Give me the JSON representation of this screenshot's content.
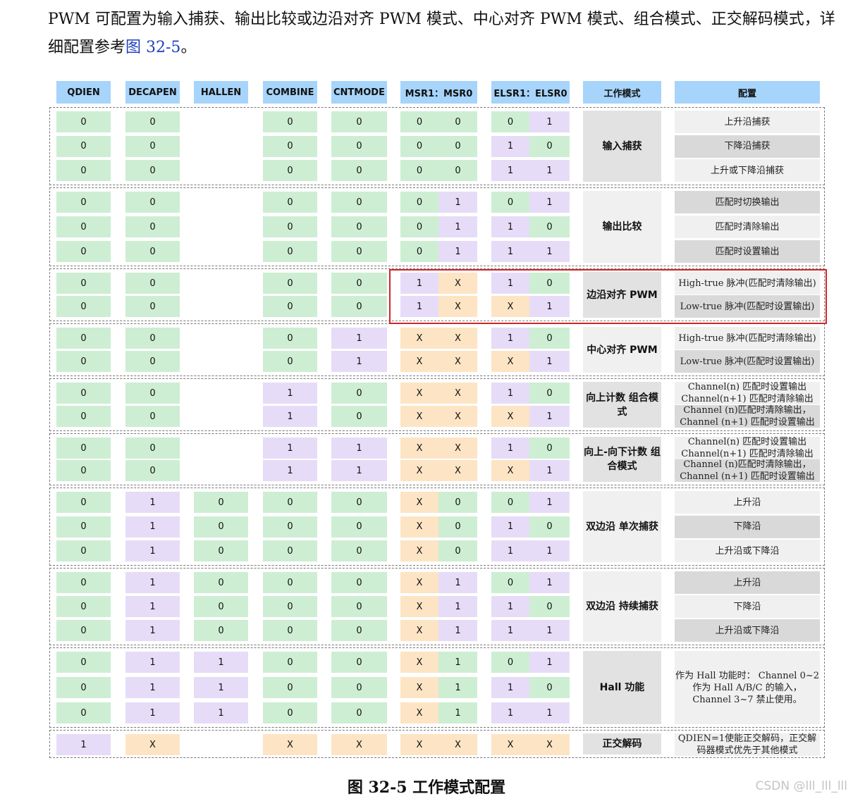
{
  "intro": {
    "text": "PWM 可配置为输入捕获、输出比较或边沿对齐 PWM 模式、中心对齐 PWM 模式、组合模式、正交解码模式，详细配置参考",
    "ref": "图 32-5",
    "tail": "。"
  },
  "headers": [
    "QDIEN",
    "DECAPEN",
    "HALLEN",
    "COMBINE",
    "CNTMODE",
    "MSR1：MSR0",
    "ELSR1：ELSR0",
    "工作模式",
    "配置"
  ],
  "groups": [
    {
      "mode": "输入捕获",
      "rows": [
        {
          "v": [
            "0",
            "0",
            "",
            "0",
            "0",
            "0",
            "0",
            "0",
            "1"
          ],
          "c": [
            "g",
            "g",
            "",
            "g",
            "g",
            "g",
            "g",
            "g",
            "p"
          ],
          "cfg": "上升沿捕获",
          "ct": "l"
        },
        {
          "v": [
            "0",
            "0",
            "",
            "0",
            "0",
            "0",
            "0",
            "1",
            "0"
          ],
          "c": [
            "g",
            "g",
            "",
            "g",
            "g",
            "g",
            "g",
            "p",
            "g"
          ],
          "cfg": "下降沿捕获",
          "ct": "d"
        },
        {
          "v": [
            "0",
            "0",
            "",
            "0",
            "0",
            "0",
            "0",
            "1",
            "1"
          ],
          "c": [
            "g",
            "g",
            "",
            "g",
            "g",
            "g",
            "g",
            "p",
            "p"
          ],
          "cfg": "上升或下降沿捕获",
          "ct": "l"
        }
      ]
    },
    {
      "mode": "输出比较",
      "rows": [
        {
          "v": [
            "0",
            "0",
            "",
            "0",
            "0",
            "0",
            "1",
            "0",
            "1"
          ],
          "c": [
            "g",
            "g",
            "",
            "g",
            "g",
            "g",
            "p",
            "g",
            "p"
          ],
          "cfg": "匹配时切换输出",
          "ct": "d"
        },
        {
          "v": [
            "0",
            "0",
            "",
            "0",
            "0",
            "0",
            "1",
            "1",
            "0"
          ],
          "c": [
            "g",
            "g",
            "",
            "g",
            "g",
            "g",
            "p",
            "p",
            "g"
          ],
          "cfg": "匹配时清除输出",
          "ct": "l"
        },
        {
          "v": [
            "0",
            "0",
            "",
            "0",
            "0",
            "0",
            "1",
            "1",
            "1"
          ],
          "c": [
            "g",
            "g",
            "",
            "g",
            "g",
            "g",
            "p",
            "p",
            "p"
          ],
          "cfg": "匹配时设置输出",
          "ct": "d"
        }
      ]
    },
    {
      "mode": "边沿对齐 PWM",
      "rows": [
        {
          "v": [
            "0",
            "0",
            "",
            "0",
            "0",
            "1",
            "X",
            "1",
            "0"
          ],
          "c": [
            "g",
            "g",
            "",
            "g",
            "g",
            "p",
            "o",
            "p",
            "g"
          ],
          "cfg": "High-true 脉冲(匹配时清除输出)",
          "ct": "l"
        },
        {
          "v": [
            "0",
            "0",
            "",
            "0",
            "0",
            "1",
            "X",
            "X",
            "1"
          ],
          "c": [
            "g",
            "g",
            "",
            "g",
            "g",
            "p",
            "o",
            "o",
            "p"
          ],
          "cfg": "Low-true 脉冲(匹配时设置输出)",
          "ct": "d"
        }
      ]
    },
    {
      "mode": "中心对齐 PWM",
      "rows": [
        {
          "v": [
            "0",
            "0",
            "",
            "0",
            "1",
            "X",
            "X",
            "1",
            "0"
          ],
          "c": [
            "g",
            "g",
            "",
            "g",
            "p",
            "o",
            "o",
            "p",
            "g"
          ],
          "cfg": "High-true 脉冲(匹配时清除输出)",
          "ct": "l"
        },
        {
          "v": [
            "0",
            "0",
            "",
            "0",
            "1",
            "X",
            "X",
            "X",
            "1"
          ],
          "c": [
            "g",
            "g",
            "",
            "g",
            "p",
            "o",
            "o",
            "o",
            "p"
          ],
          "cfg": "Low-true 脉冲(匹配时设置输出)",
          "ct": "d"
        }
      ]
    },
    {
      "mode": "向上计数 组合模式",
      "rows": [
        {
          "v": [
            "0",
            "0",
            "",
            "1",
            "0",
            "X",
            "X",
            "1",
            "0"
          ],
          "c": [
            "g",
            "g",
            "",
            "p",
            "g",
            "o",
            "o",
            "p",
            "g"
          ],
          "cfg": "Channel(n) 匹配时设置输出 Channel(n+1) 匹配时清除输出",
          "ct": "l"
        },
        {
          "v": [
            "0",
            "0",
            "",
            "1",
            "0",
            "X",
            "X",
            "X",
            "1"
          ],
          "c": [
            "g",
            "g",
            "",
            "p",
            "g",
            "o",
            "o",
            "o",
            "p"
          ],
          "cfg": "Channel (n)匹配时清除输出， Channel (n+1) 匹配时设置输出",
          "ct": "d"
        }
      ]
    },
    {
      "mode": "向上-向下计数 组合模式",
      "rows": [
        {
          "v": [
            "0",
            "0",
            "",
            "1",
            "1",
            "X",
            "X",
            "1",
            "0"
          ],
          "c": [
            "g",
            "g",
            "",
            "p",
            "p",
            "o",
            "o",
            "p",
            "g"
          ],
          "cfg": "Channel(n) 匹配时设置输出 Channel(n+1) 匹配时清除输出",
          "ct": "l"
        },
        {
          "v": [
            "0",
            "0",
            "",
            "1",
            "1",
            "X",
            "X",
            "X",
            "1"
          ],
          "c": [
            "g",
            "g",
            "",
            "p",
            "p",
            "o",
            "o",
            "o",
            "p"
          ],
          "cfg": "Channel (n)匹配时清除输出， Channel (n+1) 匹配时设置输出",
          "ct": "d"
        }
      ]
    },
    {
      "mode": "双边沿 单次捕获",
      "rows": [
        {
          "v": [
            "0",
            "1",
            "0",
            "0",
            "0",
            "X",
            "0",
            "0",
            "1"
          ],
          "c": [
            "g",
            "p",
            "g",
            "g",
            "g",
            "o",
            "g",
            "g",
            "p"
          ],
          "cfg": "上升沿",
          "ct": "l"
        },
        {
          "v": [
            "0",
            "1",
            "0",
            "0",
            "0",
            "X",
            "0",
            "1",
            "0"
          ],
          "c": [
            "g",
            "p",
            "g",
            "g",
            "g",
            "o",
            "g",
            "p",
            "g"
          ],
          "cfg": "下降沿",
          "ct": "d"
        },
        {
          "v": [
            "0",
            "1",
            "0",
            "0",
            "0",
            "X",
            "0",
            "1",
            "1"
          ],
          "c": [
            "g",
            "p",
            "g",
            "g",
            "g",
            "o",
            "g",
            "p",
            "p"
          ],
          "cfg": "上升沿或下降沿",
          "ct": "l"
        }
      ]
    },
    {
      "mode": "双边沿 持续捕获",
      "rows": [
        {
          "v": [
            "0",
            "1",
            "0",
            "0",
            "0",
            "X",
            "1",
            "0",
            "1"
          ],
          "c": [
            "g",
            "p",
            "g",
            "g",
            "g",
            "o",
            "p",
            "g",
            "p"
          ],
          "cfg": "上升沿",
          "ct": "d"
        },
        {
          "v": [
            "0",
            "1",
            "0",
            "0",
            "0",
            "X",
            "1",
            "1",
            "0"
          ],
          "c": [
            "g",
            "p",
            "g",
            "g",
            "g",
            "o",
            "p",
            "p",
            "g"
          ],
          "cfg": "下降沿",
          "ct": "l"
        },
        {
          "v": [
            "0",
            "1",
            "0",
            "0",
            "0",
            "X",
            "1",
            "1",
            "1"
          ],
          "c": [
            "g",
            "p",
            "g",
            "g",
            "g",
            "o",
            "p",
            "p",
            "p"
          ],
          "cfg": "上升沿或下降沿",
          "ct": "d"
        }
      ]
    },
    {
      "mode": "Hall 功能",
      "cfg_span": "作为 Hall 功能时： Channel 0~2 作为 Hall A/B/C 的输入， Channel 3~7 禁止使用。",
      "rows": [
        {
          "v": [
            "0",
            "1",
            "1",
            "0",
            "0",
            "X",
            "1",
            "0",
            "1"
          ],
          "c": [
            "g",
            "p",
            "p",
            "g",
            "g",
            "o",
            "g",
            "g",
            "p"
          ]
        },
        {
          "v": [
            "0",
            "1",
            "1",
            "0",
            "0",
            "X",
            "1",
            "1",
            "0"
          ],
          "c": [
            "g",
            "p",
            "p",
            "g",
            "g",
            "o",
            "g",
            "p",
            "g"
          ]
        },
        {
          "v": [
            "0",
            "1",
            "1",
            "0",
            "0",
            "X",
            "1",
            "1",
            "1"
          ],
          "c": [
            "g",
            "p",
            "p",
            "g",
            "g",
            "o",
            "g",
            "p",
            "p"
          ]
        }
      ]
    },
    {
      "mode": "正交解码",
      "rows": [
        {
          "v": [
            "1",
            "X",
            "",
            "X",
            "X",
            "X",
            "X",
            "X",
            "X"
          ],
          "c": [
            "p",
            "o",
            "",
            "o",
            "o",
            "o",
            "o",
            "o",
            "o"
          ],
          "cfg": "QDIEN=1使能正交解码，正交解码器模式优先于其他模式",
          "ct": "l"
        }
      ]
    }
  ],
  "caption": "图 32-5 工作模式配置",
  "watermark": "CSDN @lll_lll_lll"
}
